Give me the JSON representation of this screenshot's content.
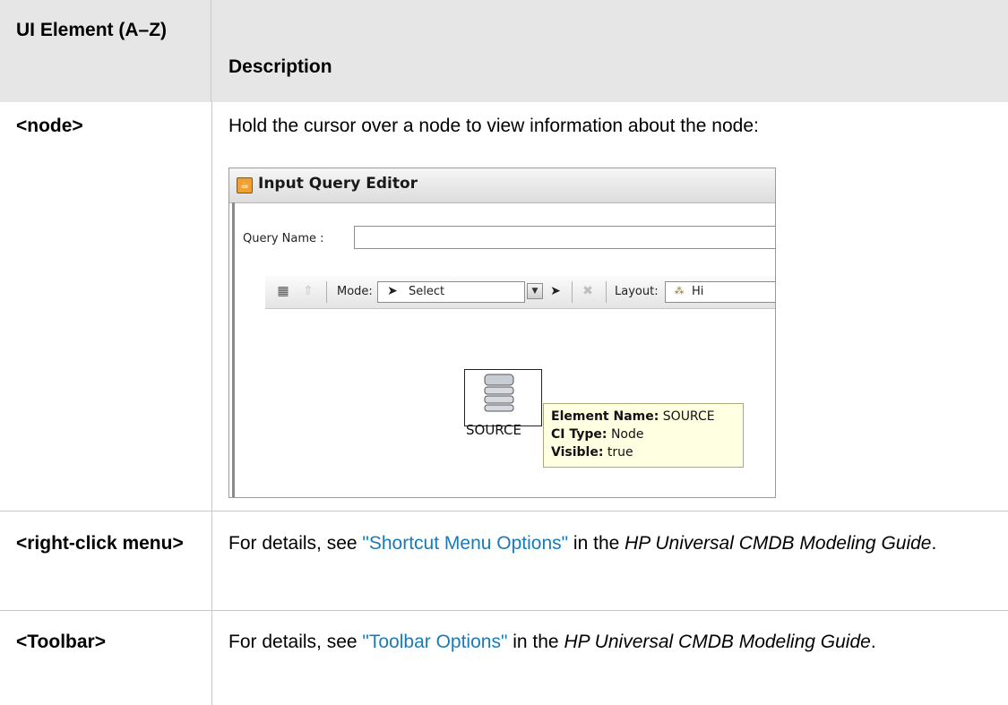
{
  "table": {
    "header": {
      "col1": "UI Element (A–Z)",
      "col2": "Description"
    },
    "rows": [
      {
        "element": "<node>",
        "description": "Hold the cursor over a node to view information about the node:"
      },
      {
        "element": "<right-click menu>",
        "desc_prefix": "For details, see ",
        "link": "\"Shortcut Menu Options\"",
        "desc_mid": " in the ",
        "guide": "HP Universal CMDB Modeling Guide",
        "desc_suffix": "."
      },
      {
        "element": "<Toolbar>",
        "desc_prefix": "For details, see ",
        "link": "\"Toolbar Options\"",
        "desc_mid": " in the ",
        "guide": "HP Universal CMDB Modeling Guide",
        "desc_suffix": "."
      }
    ]
  },
  "screenshot": {
    "window_title": "Input Query Editor",
    "query_name_label": "Query Name :",
    "query_name_value": "",
    "toolbar": {
      "mode_label": "Mode:",
      "mode_value": "Select",
      "layout_label": "Layout:",
      "layout_value": "Hi"
    },
    "node_label": "SOURCE",
    "tooltip": {
      "element_name_key": "Element Name:",
      "element_name_value": "SOURCE",
      "ci_type_key": "CI Type:",
      "ci_type_value": "Node",
      "visible_key": "Visible:",
      "visible_value": "true"
    }
  },
  "colors": {
    "header_bg": "#e6e6e6",
    "link": "#1a7ab8",
    "border": "#c8c8c8",
    "tooltip_bg": "#ffffe1"
  }
}
